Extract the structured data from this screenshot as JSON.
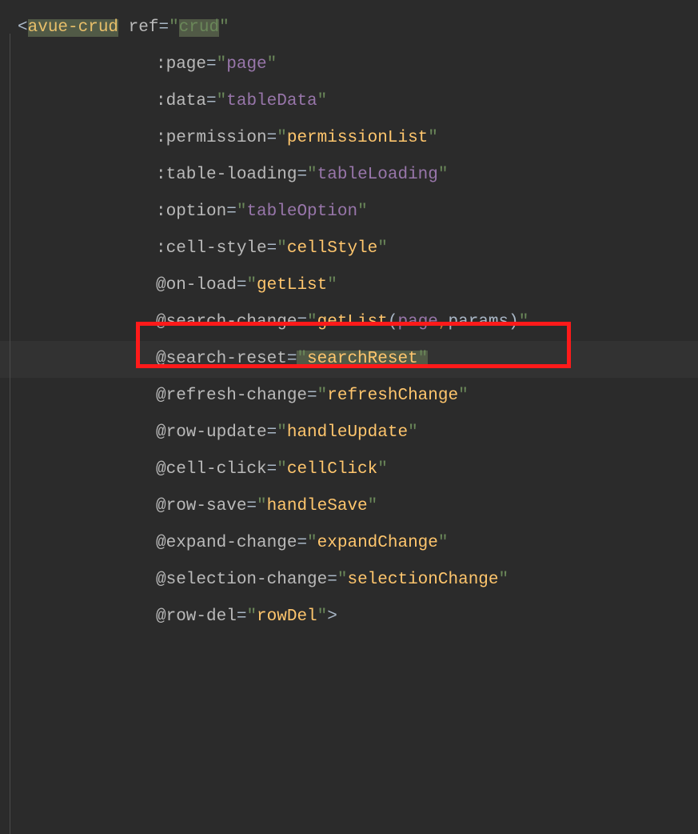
{
  "code": {
    "tagOpen": "<",
    "tagName": "avue-crud",
    "tagClose": ">",
    "attrs": [
      {
        "name": "ref",
        "eq": "=",
        "q1": "\"",
        "valueType": "highlight",
        "value": "crud",
        "q2": "\""
      },
      {
        "name": ":page",
        "eq": "=",
        "q1": "\"",
        "valueType": "purple",
        "value": "page",
        "q2": "\""
      },
      {
        "name": ":data",
        "eq": "=",
        "q1": "\"",
        "valueType": "purple",
        "value": "tableData",
        "q2": "\""
      },
      {
        "name": ":permission",
        "eq": "=",
        "q1": "\"",
        "valueType": "yellow",
        "value": "permissionList",
        "q2": "\""
      },
      {
        "name": ":table-loading",
        "eq": "=",
        "q1": "\"",
        "valueType": "purple",
        "value": "tableLoading",
        "q2": "\""
      },
      {
        "name": ":option",
        "eq": "=",
        "q1": "\"",
        "valueType": "purple",
        "value": "tableOption",
        "q2": "\""
      },
      {
        "name": ":cell-style",
        "eq": "=",
        "q1": "\"",
        "valueType": "yellow",
        "value": "cellStyle",
        "q2": "\""
      },
      {
        "name": "@on-load",
        "eq": "=",
        "q1": "\"",
        "valueType": "yellow",
        "value": "getList",
        "q2": "\""
      },
      {
        "name": "@search-change",
        "eq": "=",
        "q1": "\"",
        "valueType": "call",
        "fn": "getList",
        "p1": "(",
        "arg1": "page",
        "comma": ",",
        "space": " ",
        "arg2": "params",
        "p2": ")",
        "q2": "\""
      },
      {
        "name": "@search-reset",
        "eq": "=",
        "q1": "\"",
        "valueType": "highlight-yellow",
        "value": "searchReset",
        "q2": "\"",
        "highlightedLine": true
      },
      {
        "name": "@refresh-change",
        "eq": "=",
        "q1": "\"",
        "valueType": "yellow",
        "value": "refreshChange",
        "q2": "\""
      },
      {
        "name": "@row-update",
        "eq": "=",
        "q1": "\"",
        "valueType": "yellow",
        "value": "handleUpdate",
        "q2": "\""
      },
      {
        "name": "@cell-click",
        "eq": "=",
        "q1": "\"",
        "valueType": "yellow",
        "value": "cellClick",
        "q2": "\""
      },
      {
        "name": "@row-save",
        "eq": "=",
        "q1": "\"",
        "valueType": "yellow",
        "value": "handleSave",
        "q2": "\""
      },
      {
        "name": "@expand-change",
        "eq": "=",
        "q1": "\"",
        "valueType": "yellow",
        "value": "expandChange",
        "q2": "\""
      },
      {
        "name": "@selection-change",
        "eq": "=",
        "q1": "\"",
        "valueType": "yellow",
        "value": "selectionChange",
        "q2": "\""
      },
      {
        "name": "@row-del",
        "eq": "=",
        "q1": "\"",
        "valueType": "yellow",
        "value": "rowDel",
        "q2": "\"",
        "closeTag": true
      }
    ]
  }
}
